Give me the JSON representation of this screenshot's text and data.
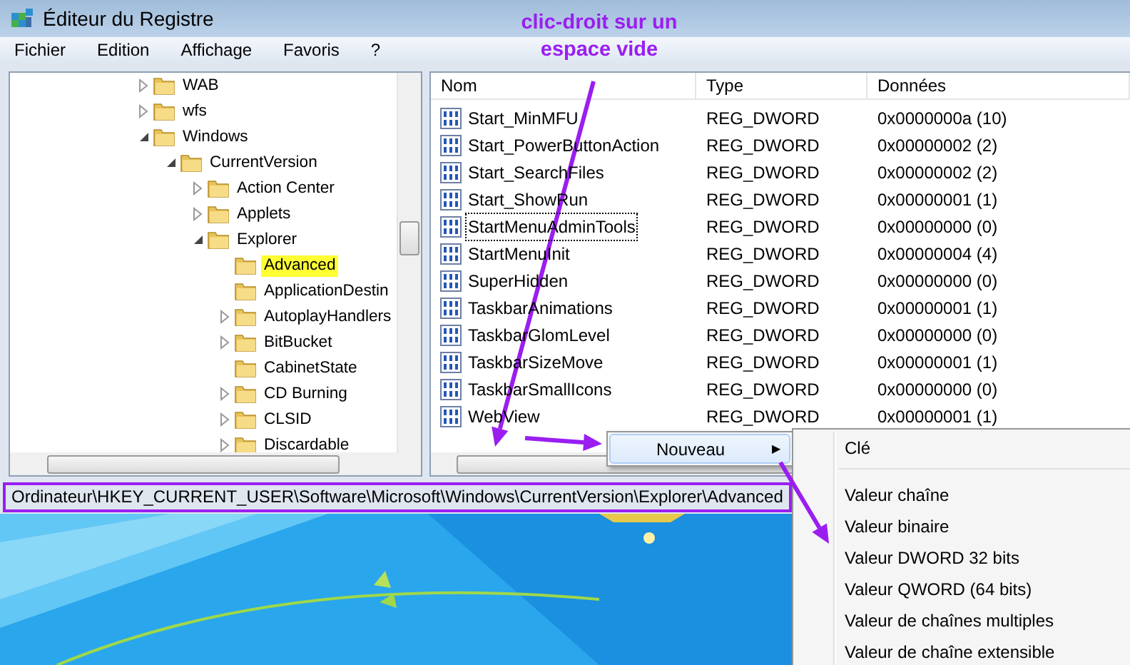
{
  "window": {
    "title": "Éditeur du Registre"
  },
  "menu": [
    "Fichier",
    "Edition",
    "Affichage",
    "Favoris",
    "?"
  ],
  "tree": [
    {
      "label": "WAB",
      "has_children": true,
      "expanded": false,
      "selected": false
    },
    {
      "label": "wfs",
      "has_children": true,
      "expanded": false,
      "selected": false
    },
    {
      "label": "Windows",
      "has_children": true,
      "expanded": true,
      "selected": false,
      "children": [
        {
          "label": "CurrentVersion",
          "has_children": true,
          "expanded": true,
          "selected": false,
          "children": [
            {
              "label": "Action Center",
              "has_children": true,
              "expanded": false,
              "selected": false
            },
            {
              "label": "Applets",
              "has_children": true,
              "expanded": false,
              "selected": false
            },
            {
              "label": "Explorer",
              "has_children": true,
              "expanded": true,
              "selected": false,
              "children": [
                {
                  "label": "Advanced",
                  "has_children": false,
                  "expanded": false,
                  "selected": true
                },
                {
                  "label": "ApplicationDestin",
                  "has_children": false,
                  "expanded": false,
                  "selected": false
                },
                {
                  "label": "AutoplayHandlers",
                  "has_children": true,
                  "expanded": false,
                  "selected": false
                },
                {
                  "label": "BitBucket",
                  "has_children": true,
                  "expanded": false,
                  "selected": false
                },
                {
                  "label": "CabinetState",
                  "has_children": false,
                  "expanded": false,
                  "selected": false
                },
                {
                  "label": "CD Burning",
                  "has_children": true,
                  "expanded": false,
                  "selected": false
                },
                {
                  "label": "CLSID",
                  "has_children": true,
                  "expanded": false,
                  "selected": false
                },
                {
                  "label": "Discardable",
                  "has_children": true,
                  "expanded": false,
                  "selected": false
                }
              ]
            }
          ]
        }
      ]
    }
  ],
  "table": {
    "columns": [
      "Nom",
      "Type",
      "Données"
    ],
    "rows": [
      {
        "name": "Start_MinMFU",
        "type": "REG_DWORD",
        "data": "0x0000000a (10)",
        "focused": false
      },
      {
        "name": "Start_PowerButtonAction",
        "type": "REG_DWORD",
        "data": "0x00000002 (2)",
        "focused": false
      },
      {
        "name": "Start_SearchFiles",
        "type": "REG_DWORD",
        "data": "0x00000002 (2)",
        "focused": false
      },
      {
        "name": "Start_ShowRun",
        "type": "REG_DWORD",
        "data": "0x00000001 (1)",
        "focused": false
      },
      {
        "name": "StartMenuAdminTools",
        "type": "REG_DWORD",
        "data": "0x00000000 (0)",
        "focused": true
      },
      {
        "name": "StartMenuInit",
        "type": "REG_DWORD",
        "data": "0x00000004 (4)",
        "focused": false
      },
      {
        "name": "SuperHidden",
        "type": "REG_DWORD",
        "data": "0x00000000 (0)",
        "focused": false
      },
      {
        "name": "TaskbarAnimations",
        "type": "REG_DWORD",
        "data": "0x00000001 (1)",
        "focused": false
      },
      {
        "name": "TaskbarGlomLevel",
        "type": "REG_DWORD",
        "data": "0x00000000 (0)",
        "focused": false
      },
      {
        "name": "TaskbarSizeMove",
        "type": "REG_DWORD",
        "data": "0x00000001 (1)",
        "focused": false
      },
      {
        "name": "TaskbarSmallIcons",
        "type": "REG_DWORD",
        "data": "0x00000000 (0)",
        "focused": false
      },
      {
        "name": "WebView",
        "type": "REG_DWORD",
        "data": "0x00000001 (1)",
        "focused": false
      }
    ]
  },
  "status_bar": "Ordinateur\\HKEY_CURRENT_USER\\Software\\Microsoft\\Windows\\CurrentVersion\\Explorer\\Advanced",
  "context_menu": [
    {
      "label": "Nouveau",
      "arrow": "▶",
      "selected": true
    }
  ],
  "submenu": [
    {
      "kind": "item",
      "label": "Clé"
    },
    {
      "kind": "separator"
    },
    {
      "kind": "item",
      "label": "Valeur chaîne"
    },
    {
      "kind": "item",
      "label": "Valeur binaire"
    },
    {
      "kind": "item",
      "label": "Valeur DWORD 32 bits"
    },
    {
      "kind": "item",
      "label": "Valeur QWORD (64 bits)"
    },
    {
      "kind": "item",
      "label": "Valeur de chaînes multiples"
    },
    {
      "kind": "item",
      "label": "Valeur de chaîne extensible"
    }
  ],
  "annotation": {
    "lines": [
      "clic-droit sur un",
      "espace vide"
    ]
  }
}
